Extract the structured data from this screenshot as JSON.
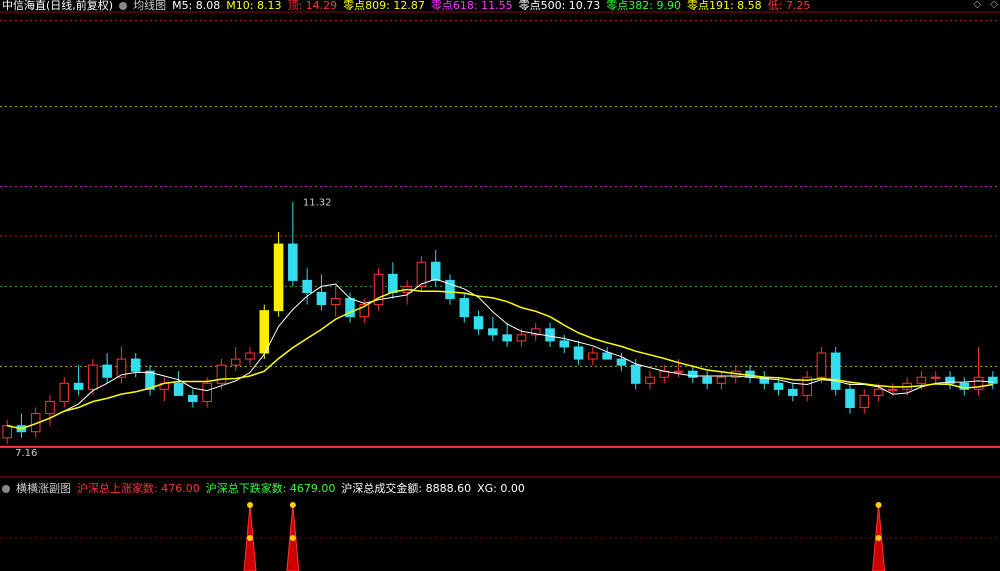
{
  "main_legend": {
    "title": "中信海直(日线,前复权)",
    "ma_name": "均线图",
    "items": [
      {
        "label": "M5: 8.08",
        "color": "#ffffff"
      },
      {
        "label": "M10: 8.13",
        "color": "#ffff00"
      },
      {
        "label": "顶: 14.29",
        "color": "#ff3333"
      },
      {
        "label": "零点809: 12.87",
        "color": "#ffff00"
      },
      {
        "label": "零点618: 11.55",
        "color": "#ff33ff"
      },
      {
        "label": "零点500: 10.73",
        "color": "#ffffff"
      },
      {
        "label": "零点382: 9.90",
        "color": "#33ff33"
      },
      {
        "label": "零点191: 8.58",
        "color": "#ffff00"
      },
      {
        "label": "低: 7.25",
        "color": "#ff3333"
      }
    ]
  },
  "top_right": {
    "diamond": "◇",
    "arrow": "◇"
  },
  "sub_legend": {
    "title": "横横涨副图",
    "items": [
      {
        "label": "沪深总上涨家数: 476.00",
        "color": "#ff3333"
      },
      {
        "label": "沪深总下跌家数: 4679.00",
        "color": "#33ff33"
      },
      {
        "label": "沪深总成交金额: 8888.60",
        "color": "#ffffff"
      },
      {
        "label": "XG: 0.00",
        "color": "#ffffff"
      }
    ]
  },
  "chart_data": {
    "type": "candlestick",
    "high_label": "11.32",
    "low_label": "7.16",
    "price_range": [
      7.0,
      14.4
    ],
    "levels": [
      {
        "name": "顶",
        "value": 14.29,
        "color": "#ff3333"
      },
      {
        "name": "零点809",
        "value": 12.87,
        "color": "#ffff00"
      },
      {
        "name": "零点618",
        "value": 11.55,
        "color": "#ff33ff"
      },
      {
        "name": "零点500",
        "value": 10.73,
        "color": "#ff3333"
      },
      {
        "name": "零点382",
        "value": 9.9,
        "color": "#33ff33"
      },
      {
        "name": "零点191",
        "value": 8.58,
        "color": "#ffff00"
      },
      {
        "name": "低",
        "value": 7.25,
        "color": "#ff3333"
      }
    ],
    "candles": [
      [
        7.4,
        7.7,
        7.3,
        7.6
      ],
      [
        7.6,
        7.8,
        7.4,
        7.5
      ],
      [
        7.5,
        7.9,
        7.4,
        7.8
      ],
      [
        7.8,
        8.1,
        7.6,
        8.0
      ],
      [
        8.0,
        8.4,
        7.9,
        8.3
      ],
      [
        8.3,
        8.6,
        8.1,
        8.2
      ],
      [
        8.2,
        8.7,
        8.1,
        8.6
      ],
      [
        8.6,
        8.8,
        8.3,
        8.4
      ],
      [
        8.4,
        8.9,
        8.3,
        8.7
      ],
      [
        8.7,
        8.8,
        8.4,
        8.5
      ],
      [
        8.5,
        8.6,
        8.1,
        8.2
      ],
      [
        8.2,
        8.4,
        8.0,
        8.3
      ],
      [
        8.3,
        8.5,
        8.1,
        8.1
      ],
      [
        8.1,
        8.2,
        7.9,
        8.0
      ],
      [
        8.0,
        8.4,
        7.9,
        8.3
      ],
      [
        8.3,
        8.7,
        8.2,
        8.6
      ],
      [
        8.6,
        8.9,
        8.5,
        8.7
      ],
      [
        8.7,
        8.9,
        8.6,
        8.8
      ],
      [
        8.8,
        9.6,
        8.7,
        9.5
      ],
      [
        9.5,
        10.8,
        9.4,
        10.6
      ],
      [
        10.6,
        11.3,
        9.9,
        10.0
      ],
      [
        10.0,
        10.2,
        9.6,
        9.8
      ],
      [
        9.8,
        10.1,
        9.5,
        9.6
      ],
      [
        9.6,
        9.9,
        9.4,
        9.7
      ],
      [
        9.7,
        9.8,
        9.3,
        9.4
      ],
      [
        9.4,
        9.7,
        9.3,
        9.6
      ],
      [
        9.6,
        10.2,
        9.5,
        10.1
      ],
      [
        10.1,
        10.3,
        9.7,
        9.8
      ],
      [
        9.8,
        10.0,
        9.6,
        9.9
      ],
      [
        9.9,
        10.4,
        9.8,
        10.3
      ],
      [
        10.3,
        10.5,
        9.9,
        10.0
      ],
      [
        10.0,
        10.1,
        9.6,
        9.7
      ],
      [
        9.7,
        9.8,
        9.3,
        9.4
      ],
      [
        9.4,
        9.5,
        9.1,
        9.2
      ],
      [
        9.2,
        9.4,
        9.0,
        9.1
      ],
      [
        9.1,
        9.3,
        8.9,
        9.0
      ],
      [
        9.0,
        9.2,
        8.9,
        9.1
      ],
      [
        9.1,
        9.3,
        9.0,
        9.2
      ],
      [
        9.2,
        9.3,
        8.9,
        9.0
      ],
      [
        9.0,
        9.1,
        8.8,
        8.9
      ],
      [
        8.9,
        9.0,
        8.6,
        8.7
      ],
      [
        8.7,
        8.9,
        8.6,
        8.8
      ],
      [
        8.8,
        8.9,
        8.7,
        8.7
      ],
      [
        8.7,
        8.8,
        8.5,
        8.6
      ],
      [
        8.6,
        8.7,
        8.2,
        8.3
      ],
      [
        8.3,
        8.5,
        8.2,
        8.4
      ],
      [
        8.4,
        8.6,
        8.3,
        8.5
      ],
      [
        8.5,
        8.7,
        8.4,
        8.5
      ],
      [
        8.5,
        8.6,
        8.3,
        8.4
      ],
      [
        8.4,
        8.5,
        8.2,
        8.3
      ],
      [
        8.3,
        8.5,
        8.2,
        8.4
      ],
      [
        8.4,
        8.6,
        8.3,
        8.5
      ],
      [
        8.5,
        8.6,
        8.3,
        8.4
      ],
      [
        8.4,
        8.5,
        8.2,
        8.3
      ],
      [
        8.3,
        8.4,
        8.1,
        8.2
      ],
      [
        8.2,
        8.3,
        8.0,
        8.1
      ],
      [
        8.1,
        8.5,
        8.0,
        8.4
      ],
      [
        8.4,
        8.9,
        8.3,
        8.8
      ],
      [
        8.8,
        8.9,
        8.1,
        8.2
      ],
      [
        8.2,
        8.3,
        7.8,
        7.9
      ],
      [
        7.9,
        8.2,
        7.8,
        8.1
      ],
      [
        8.1,
        8.3,
        8.0,
        8.2
      ],
      [
        8.2,
        8.3,
        8.1,
        8.2
      ],
      [
        8.2,
        8.4,
        8.1,
        8.3
      ],
      [
        8.3,
        8.5,
        8.2,
        8.4
      ],
      [
        8.4,
        8.5,
        8.3,
        8.4
      ],
      [
        8.4,
        8.5,
        8.2,
        8.3
      ],
      [
        8.3,
        8.4,
        8.1,
        8.2
      ],
      [
        8.2,
        8.9,
        8.1,
        8.4
      ],
      [
        8.4,
        8.5,
        8.2,
        8.3
      ]
    ],
    "sub_signals": [
      {
        "index": 17
      },
      {
        "index": 20
      },
      {
        "index": 61
      }
    ]
  }
}
